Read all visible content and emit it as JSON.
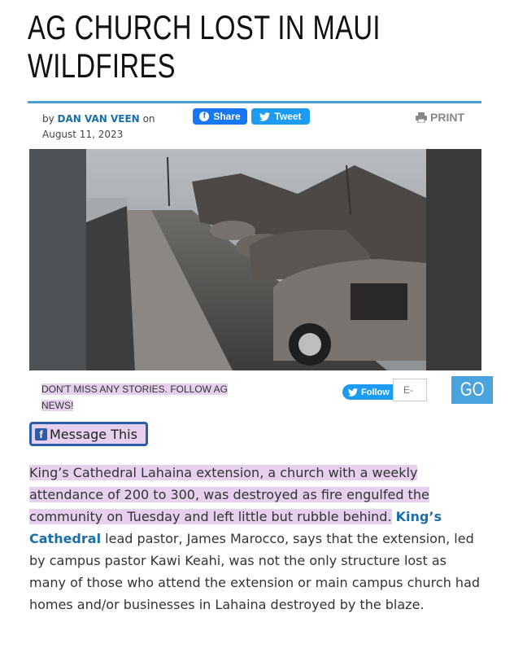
{
  "article": {
    "title": "AG CHURCH LOST IN MAUI WILDFIRES",
    "byline_prefix": "by",
    "author": "DAN VAN VEEN",
    "byline_on": "on",
    "date": "August 11, 2023",
    "body": {
      "highlighted": "King’s Cathedral Lahaina extension, a church with a weekly attendance of 200 to 300, was destroyed as fire engulfed the community on Tuesday and left little but rubble behind.",
      "link_text": "King’s Cathedral",
      "rest": "lead pastor, James Marocco, says that the extension, led by campus pastor Kawi Keahi, was not the only structure lost as many of those who attend the extension or main campus church had homes and/or businesses in Lahaina destroyed by the blaze."
    }
  },
  "social": {
    "share_label": "Share",
    "tweet_label": "Tweet",
    "print_label": "PRINT",
    "follow_label": "Follow",
    "message_label": "Message This"
  },
  "subscribe": {
    "prompt": "DON'T MISS ANY STORIES. FOLLOW AG NEWS!",
    "email_placeholder": "E-",
    "go_label": "GO"
  },
  "colors": {
    "accent": "#4a9fd8",
    "link": "#1a6fa8",
    "highlight": "#e6d0ee",
    "facebook": "#1877f2",
    "twitter": "#1d9bf0"
  },
  "icons": [
    "facebook-icon",
    "twitter-bird-icon",
    "printer-icon",
    "facebook-square-icon"
  ]
}
